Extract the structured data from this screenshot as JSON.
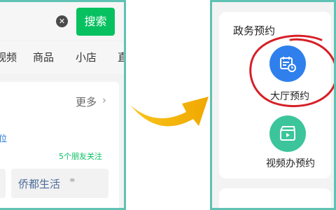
{
  "left": {
    "search": {
      "clear_icon": "close-circle-icon",
      "button_label": "搜索"
    },
    "tabs": [
      "视频",
      "商品",
      "小店",
      "直"
    ],
    "card": {
      "more_label": "更多",
      "location_text": "位",
      "friends_text": "5个朋友关注",
      "chip_text": "侨都生活",
      "chip_icon": "link-icon"
    }
  },
  "right": {
    "section_title": "政务预约",
    "services": [
      {
        "label": "大厅预约",
        "icon": "calendar-clock-icon"
      },
      {
        "label": "视频办预约",
        "icon": "video-clapper-icon"
      }
    ]
  },
  "colors": {
    "panel_border": "#5fc2b4",
    "search_green": "#07c160",
    "hall_icon_blue": "#2f80ed",
    "video_icon_green": "#3cc59a",
    "annotation_red": "#d61f26",
    "arrow_yellow": "#f5b800"
  }
}
